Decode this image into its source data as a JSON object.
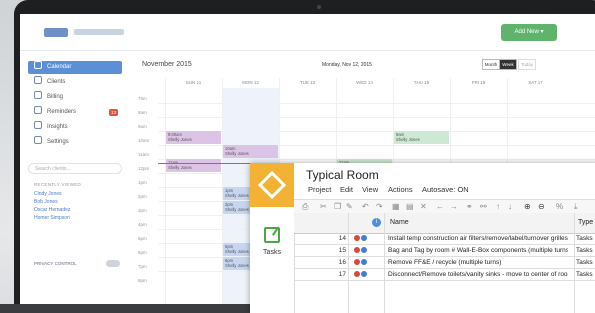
{
  "app": {
    "add_new_label": "Add New ▾"
  },
  "sidebar": {
    "items": [
      {
        "label": "Calendar",
        "icon": "calendar-icon",
        "active": true
      },
      {
        "label": "Clients",
        "icon": "clients-icon"
      },
      {
        "label": "Billing",
        "icon": "billing-icon"
      },
      {
        "label": "Reminders",
        "icon": "reminders-icon",
        "badge": "13"
      },
      {
        "label": "Insights",
        "icon": "insights-icon"
      },
      {
        "label": "Settings",
        "icon": "settings-icon"
      }
    ],
    "search_placeholder": "Search clients...",
    "recently_viewed_title": "RECENTLY VIEWED",
    "recent": [
      "Cindy Jones",
      "Bob Jones",
      "Oscar Hernadez",
      "Homer Simpson"
    ],
    "privacy_label": "PRIVACY CONTROL"
  },
  "calendar": {
    "month": "November 2015",
    "week_label": "Monday, Nov 12, 2015",
    "views": [
      "Month",
      "Week",
      "Today"
    ],
    "days": [
      "SUN 11",
      "MON 12",
      "TUE 13",
      "WED 14",
      "THU 15",
      "FRI 16",
      "SAT 17"
    ],
    "hours": [
      "7am",
      "8am",
      "9am",
      "10am",
      "11am",
      "12pm",
      "1pm",
      "2pm",
      "3pm",
      "4pm",
      "5pm",
      "6pm",
      "7pm",
      "8pm"
    ],
    "events": [
      {
        "time": "9:00am",
        "name": "Shelly Jones",
        "color": "p"
      },
      {
        "time": "10am",
        "name": "Shelly Jones",
        "color": "p"
      },
      {
        "time": "11am",
        "name": "Shelly Jones",
        "color": "p"
      },
      {
        "time": "9am",
        "name": "Shelly Jones",
        "color": "g"
      },
      {
        "time": "11am",
        "name": "Shelly Jones",
        "color": "g"
      },
      {
        "time": "1pm",
        "name": "Shelly Jones",
        "color": "b"
      },
      {
        "time": "2pm",
        "name": "Shelly Jones",
        "color": "b"
      },
      {
        "time": "5pm",
        "name": "Shelly Jones",
        "color": "b"
      },
      {
        "time": "6pm",
        "name": "Shelly Jones",
        "color": "b"
      }
    ]
  },
  "task_window": {
    "title": "Typical Room",
    "menu": [
      "Project",
      "Edit",
      "View",
      "Actions",
      "Autosave: ON"
    ],
    "side_label": "Tasks",
    "columns": {
      "name": "Name",
      "type": "Type"
    },
    "rows": [
      {
        "num": "14",
        "name": "Install temp construction air filters/remove/label/turnover grilles t",
        "type": "Tasks"
      },
      {
        "num": "15",
        "name": "Bag and Tag by room # Wall-E-Box components (multiple turns)",
        "type": "Tasks"
      },
      {
        "num": "16",
        "name": "Remove FF&E / recycle (multiple turns)",
        "type": "Tasks"
      },
      {
        "num": "17",
        "name": "Disconnect/Remove toilets/vanity sinks - move to center of roor",
        "type": "Tasks"
      }
    ]
  }
}
